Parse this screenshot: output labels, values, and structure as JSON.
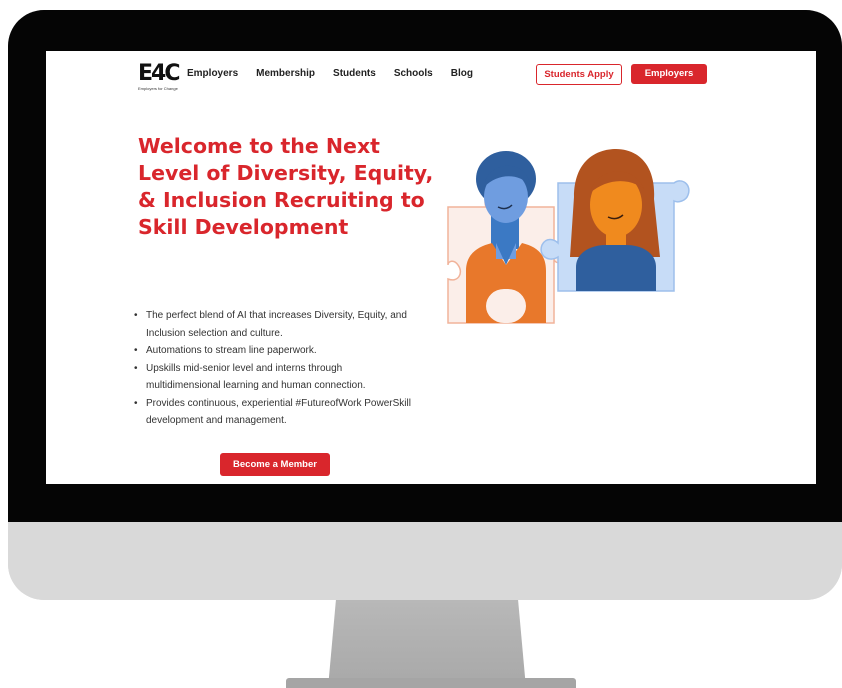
{
  "nav": {
    "logo_mark": "E4C",
    "logo_tagline": "Employers for Change",
    "links": [
      "Employers",
      "Membership",
      "Students",
      "Schools",
      "Blog"
    ],
    "students_apply_label": "Students Apply",
    "employers_button_label": "Employers"
  },
  "hero": {
    "title_lines": [
      "Welcome to the Next",
      "Level of Diversity, Equity,",
      "& Inclusion Recruiting to",
      "Skill Development"
    ],
    "bullets": [
      "The perfect blend of AI that increases Diversity, Equity, and Inclusion selection and culture.",
      "Automations to stream line paperwork.",
      "Upskills mid-senior level and interns through multidimensional learning and human connection.",
      "Provides continuous, experiential #FutureofWork PowerSkill development and management."
    ],
    "cta_label": "Become a Member"
  },
  "colors": {
    "accent": "#d9262c",
    "bezel": "#050505",
    "chin": "#d9d9d9"
  }
}
